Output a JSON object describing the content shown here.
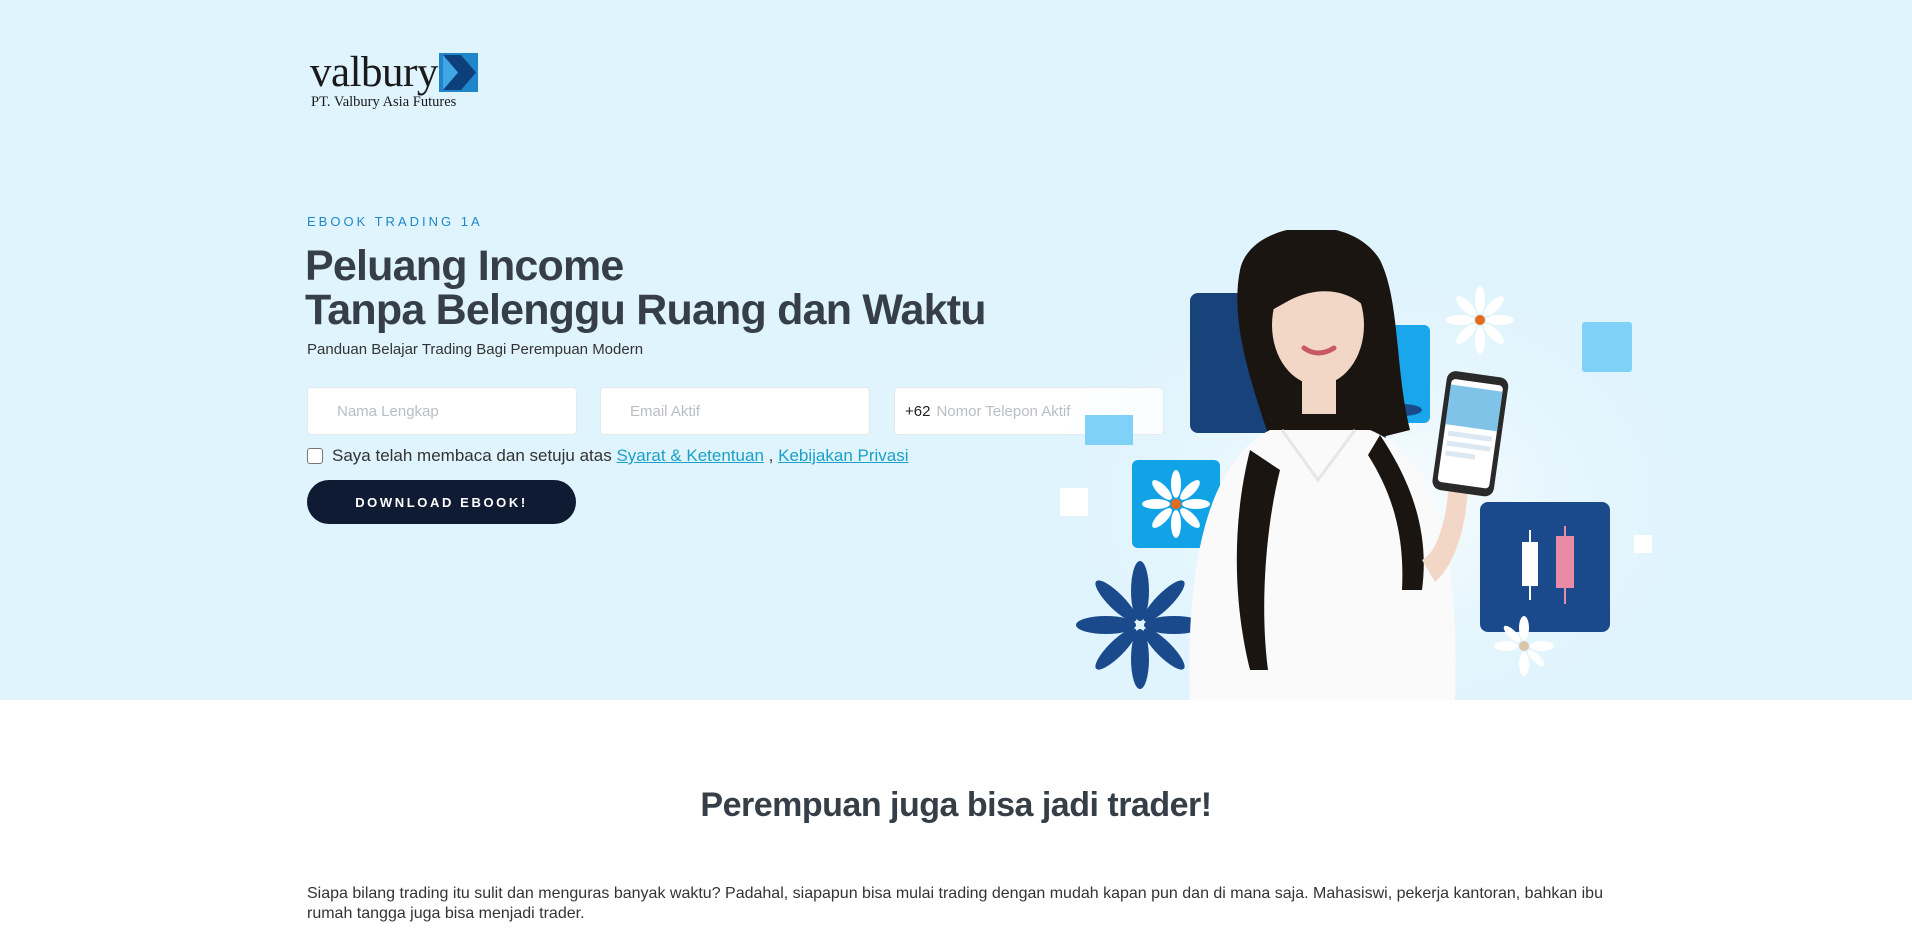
{
  "brand": {
    "logo_text": "valbury",
    "company": "PT. Valbury Asia Futures",
    "accent": "#1f87c9",
    "dark": "#0e1b33"
  },
  "hero": {
    "eyebrow": "EBOOK TRADING 1A",
    "title_line1": "Peluang Income",
    "title_line2": "Tanpa Belenggu Ruang dan Waktu",
    "subtitle": "Panduan Belajar Trading Bagi Perempuan Modern"
  },
  "form": {
    "name_placeholder": "Nama Lengkap",
    "email_placeholder": "Email Aktif",
    "phone_prefix": "+62",
    "phone_placeholder": "Nomor Telepon Aktif",
    "consent_text": "Saya telah membaca dan setuju atas",
    "terms_link": "Syarat & Ketentuan",
    "separator": ",",
    "privacy_link": "Kebijakan Privasi",
    "submit_label": "DOWNLOAD EBOOK!"
  },
  "section": {
    "title": "Perempuan juga bisa jadi trader!",
    "body": "Siapa bilang trading itu sulit dan menguras banyak waktu? Padahal, siapapun bisa mulai trading dengan mudah kapan pun dan di mana saja. Mahasiswi, pekerja kantoran, bahkan ibu rumah tangga juga bisa menjadi trader."
  },
  "icons": [
    "valbury-logo-icon",
    "hero-illustration"
  ]
}
